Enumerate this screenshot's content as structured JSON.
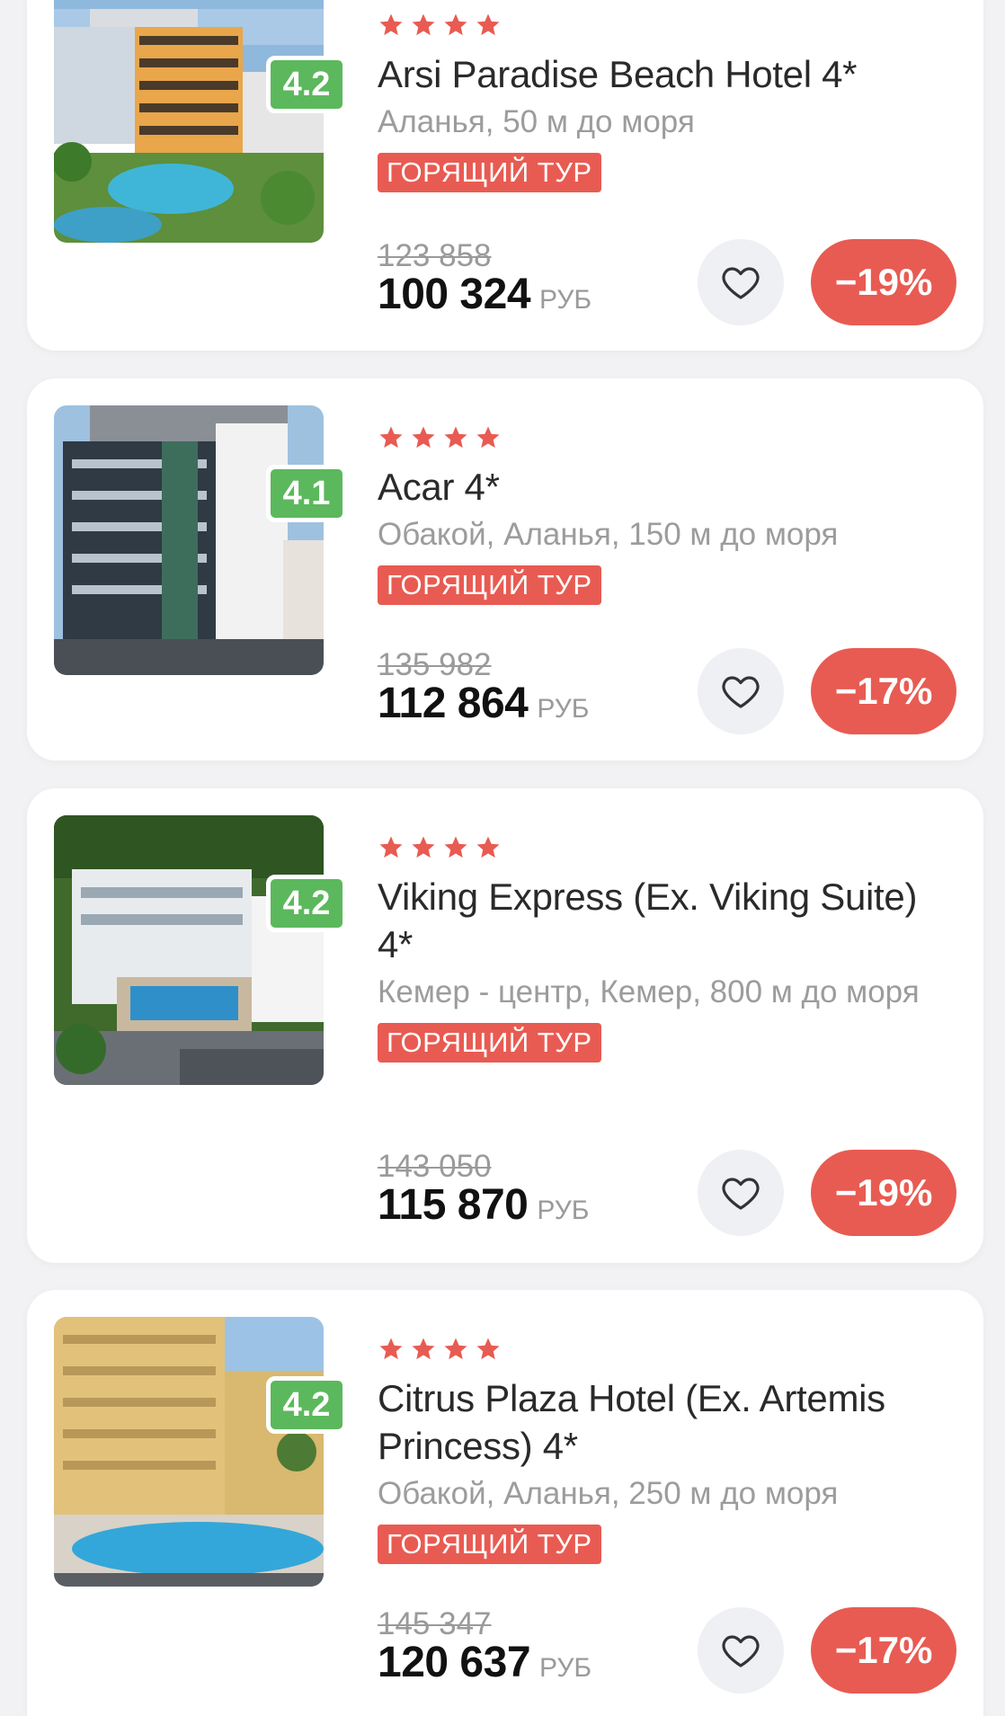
{
  "hotels": [
    {
      "rating": "4.2",
      "stars": 4,
      "name": "Arsi Paradise Beach Hotel 4*",
      "location": "Аланья, 50 м до моря",
      "badge": "ГОРЯЩИЙ ТУР",
      "old_price": "123 858",
      "price": "100 324",
      "currency": "РУБ",
      "discount": "−19%"
    },
    {
      "rating": "4.1",
      "stars": 4,
      "name": "Acar 4*",
      "location": "Обакой, Аланья, 150 м до моря",
      "badge": "ГОРЯЩИЙ ТУР",
      "old_price": "135 982",
      "price": "112 864",
      "currency": "РУБ",
      "discount": "−17%"
    },
    {
      "rating": "4.2",
      "stars": 4,
      "name": "Viking Express (Ex. Viking Suite) 4*",
      "location": "Кемер - центр, Кемер, 800 м до моря",
      "badge": "ГОРЯЩИЙ ТУР",
      "old_price": "143 050",
      "price": "115 870",
      "currency": "РУБ",
      "discount": "−19%"
    },
    {
      "rating": "4.2",
      "stars": 4,
      "name": "Citrus Plaza Hotel (Ex. Artemis Princess) 4*",
      "location": "Обакой, Аланья, 250 м до моря",
      "badge": "ГОРЯЩИЙ ТУР",
      "old_price": "145 347",
      "price": "120 637",
      "currency": "РУБ",
      "discount": "−17%"
    }
  ],
  "icons": {
    "star": "star-icon",
    "favorite": "heart-icon"
  },
  "colors": {
    "accent": "#e85b52",
    "rating": "#5cb85c",
    "title": "#2a2a2a",
    "muted": "#9c9c9c"
  }
}
